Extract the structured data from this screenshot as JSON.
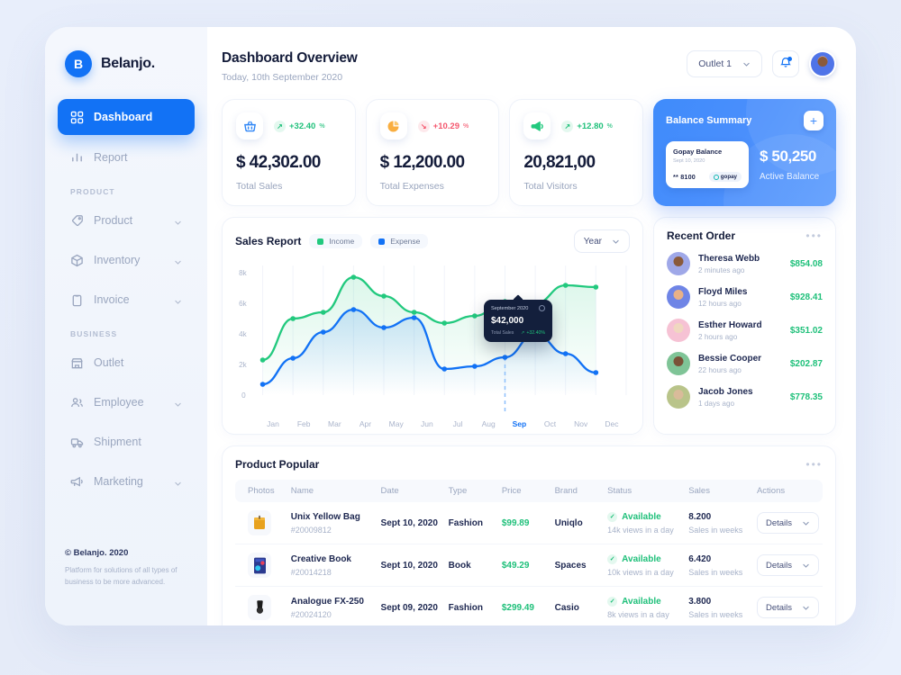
{
  "brand": {
    "initial": "B",
    "name": "Belanjo."
  },
  "sidebar": {
    "nav_main": [
      {
        "label": "Dashboard",
        "icon": "grid-icon",
        "active": true,
        "chevron": false
      },
      {
        "label": "Report",
        "icon": "bar-chart-icon",
        "active": false,
        "chevron": false
      }
    ],
    "section_product": "PRODUCT",
    "nav_product": [
      {
        "label": "Product",
        "icon": "tag-icon",
        "chevron": true
      },
      {
        "label": "Inventory",
        "icon": "box-icon",
        "chevron": true
      },
      {
        "label": "Invoice",
        "icon": "clipboard-icon",
        "chevron": true
      }
    ],
    "section_business": "BUSINESS",
    "nav_business": [
      {
        "label": "Outlet",
        "icon": "store-icon",
        "chevron": false
      },
      {
        "label": "Employee",
        "icon": "users-icon",
        "chevron": true
      },
      {
        "label": "Shipment",
        "icon": "truck-icon",
        "chevron": false
      },
      {
        "label": "Marketing",
        "icon": "megaphone-icon",
        "chevron": true
      }
    ],
    "footer": {
      "copyright": "© Belanjo. 2020",
      "tagline": "Platform for solutions of all types of business to be more advanced."
    }
  },
  "header": {
    "title": "Dashboard Overview",
    "subtitle": "Today, 10th September 2020",
    "outlet_value": "Outlet 1",
    "bell_icon": "bell-icon",
    "avatar_icon": "user-avatar"
  },
  "stats": [
    {
      "icon": "shopping-basket-icon",
      "trend": "up",
      "trend_value": "+32.40",
      "trend_unit": "%",
      "value": "$ 42,302.00",
      "label": "Total Sales"
    },
    {
      "icon": "pie-chart-icon",
      "trend": "down",
      "trend_value": "+10.29",
      "trend_unit": "%",
      "value": "$ 12,200.00",
      "label": "Total Expenses"
    },
    {
      "icon": "megaphone-icon",
      "trend": "up",
      "trend_value": "+12.80",
      "trend_unit": "%",
      "value": "20,821,00",
      "label": "Total Visitors"
    }
  ],
  "balance": {
    "title": "Balance Summary",
    "add_label": "+",
    "card_title": "Gopay Balance",
    "card_date": "Sept 10, 2020",
    "card_number": "** 8100",
    "card_brand": "gopay",
    "amount": "$ 50,250",
    "amount_label": "Active Balance"
  },
  "sales_report": {
    "title": "Sales Report",
    "legend": [
      {
        "name": "Income",
        "color": "#22c97e"
      },
      {
        "name": "Expense",
        "color": "#1272f5"
      }
    ],
    "range_value": "Year",
    "tooltip": {
      "date": "September 2020",
      "value": "$42,000",
      "label": "Total Sales",
      "badge": "+32.40%"
    }
  },
  "chart_data": {
    "type": "line",
    "title": "Sales Report",
    "xlabel": "",
    "ylabel": "",
    "ylim": [
      0,
      8000
    ],
    "yticks": [
      "0",
      "2k",
      "4k",
      "6k",
      "8k"
    ],
    "grid": true,
    "legend_position": "top-left",
    "selected_category": "Sep",
    "categories": [
      "Jan",
      "Feb",
      "Mar",
      "Apr",
      "May",
      "Jun",
      "Jul",
      "Aug",
      "Sep",
      "Oct",
      "Nov",
      "Dec"
    ],
    "series": [
      {
        "name": "Income",
        "color": "#22c97e",
        "values": [
          2300,
          5000,
          5400,
          7700,
          6500,
          5400,
          4700,
          5200,
          6100,
          6000,
          7200,
          7100
        ]
      },
      {
        "name": "Expense",
        "color": "#1272f5",
        "values": [
          700,
          2400,
          4100,
          5600,
          4400,
          3200,
          1700,
          1850,
          2500,
          4000,
          2750,
          1450
        ]
      }
    ]
  },
  "recent_order": {
    "title": "Recent Order",
    "menu_icon": "more-horizontal-icon",
    "items": [
      {
        "name": "Theresa Webb",
        "time": "2 minutes ago",
        "amount": "$854.08",
        "av_bg": "#9fa8e8",
        "av_face": "#8a5a3b"
      },
      {
        "name": "Floyd Miles",
        "time": "12 hours ago",
        "amount": "$928.41",
        "av_bg": "#6f85e6",
        "av_face": "#e8b187"
      },
      {
        "name": "Esther Howard",
        "time": "2 hours ago",
        "amount": "$351.02",
        "av_bg": "#f6c2d4",
        "av_face": "#f0d7c0"
      },
      {
        "name": "Bessie Cooper",
        "time": "22 hours ago",
        "amount": "$202.87",
        "av_bg": "#7fc497",
        "av_face": "#7a5238"
      },
      {
        "name": "Jacob Jones",
        "time": "1 days ago",
        "amount": "$778.35",
        "av_bg": "#b9c48a",
        "av_face": "#d9bb9a"
      }
    ]
  },
  "product_popular": {
    "title": "Product Popular",
    "menu_icon": "more-horizontal-icon",
    "columns": [
      "Photos",
      "Name",
      "Date",
      "Type",
      "Price",
      "Brand",
      "Status",
      "Sales",
      "Actions"
    ],
    "rows": [
      {
        "photo": "yellow-bag-thumbnail",
        "name": "Unix Yellow Bag",
        "id": "#20009812",
        "date": "Sept 10, 2020",
        "type": "Fashion",
        "price": "$99.89",
        "brand": "Uniqlo",
        "status": "Available",
        "status_sub": "14k views in a day",
        "sales": "8.200",
        "sales_sub": "Sales in weeks",
        "action": "Details"
      },
      {
        "photo": "book-thumbnail",
        "name": "Creative Book",
        "id": "#20014218",
        "date": "Sept 10, 2020",
        "type": "Book",
        "price": "$49.29",
        "brand": "Spaces",
        "status": "Available",
        "status_sub": "10k views in a day",
        "sales": "6.420",
        "sales_sub": "Sales in weeks",
        "action": "Details"
      },
      {
        "photo": "watch-thumbnail",
        "name": "Analogue FX-250",
        "id": "#20024120",
        "date": "Sept 09, 2020",
        "type": "Fashion",
        "price": "$299.49",
        "brand": "Casio",
        "status": "Available",
        "status_sub": "8k views in a day",
        "sales": "3.800",
        "sales_sub": "Sales in weeks",
        "action": "Details"
      }
    ]
  },
  "colors": {
    "accent_blue": "#1272f5",
    "green": "#22c97e",
    "red": "#f4566d",
    "orange": "#f9ae40",
    "dark": "#141c3a",
    "muted": "#9aa6bf"
  }
}
